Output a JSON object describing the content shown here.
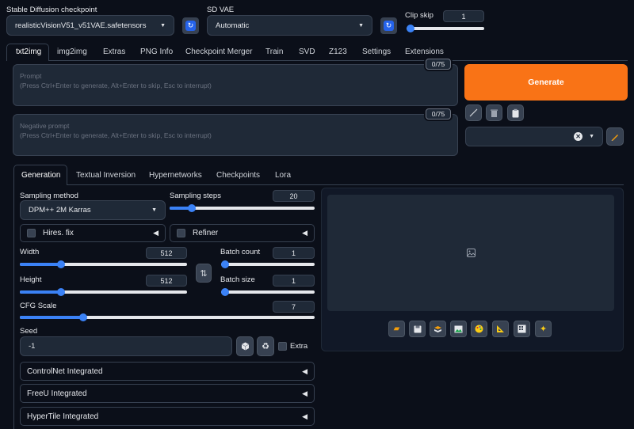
{
  "top": {
    "checkpoint_label": "Stable Diffusion checkpoint",
    "checkpoint_value": "realisticVisionV51_v51VAE.safetensors",
    "vae_label": "SD VAE",
    "vae_value": "Automatic",
    "clip_skip_label": "Clip skip",
    "clip_skip_value": "1",
    "clip_skip_level": 0
  },
  "main_tabs": [
    "txt2img",
    "img2img",
    "Extras",
    "PNG Info",
    "Checkpoint Merger",
    "Train",
    "SVD",
    "Z123",
    "Settings",
    "Extensions"
  ],
  "prompt": {
    "label": "Prompt",
    "hint": "(Press Ctrl+Enter to generate, Alt+Enter to skip, Esc to interrupt)",
    "counter": "0/75"
  },
  "negative": {
    "label": "Negative prompt",
    "hint": "(Press Ctrl+Enter to generate, Alt+Enter to skip, Esc to interrupt)",
    "counter": "0/75"
  },
  "generate_label": "Generate",
  "sub_tabs": [
    "Generation",
    "Textual Inversion",
    "Hypernetworks",
    "Checkpoints",
    "Lora"
  ],
  "params": {
    "sampling_method_label": "Sampling method",
    "sampling_method_value": "DPM++ 2M Karras",
    "sampling_steps_label": "Sampling steps",
    "sampling_steps_value": "20",
    "hires_label": "Hires. fix",
    "refiner_label": "Refiner",
    "width_label": "Width",
    "width_value": "512",
    "height_label": "Height",
    "height_value": "512",
    "batch_count_label": "Batch count",
    "batch_count_value": "1",
    "batch_size_label": "Batch size",
    "batch_size_value": "1",
    "cfg_label": "CFG Scale",
    "cfg_value": "7",
    "seed_label": "Seed",
    "seed_value": "-1",
    "extra_label": "Extra"
  },
  "accordions": [
    "ControlNet Integrated",
    "FreeU Integrated",
    "HyperTile Integrated"
  ],
  "colors": {
    "accent": "#3b82f6",
    "generate": "#f97316",
    "background": "#0b0f19"
  }
}
